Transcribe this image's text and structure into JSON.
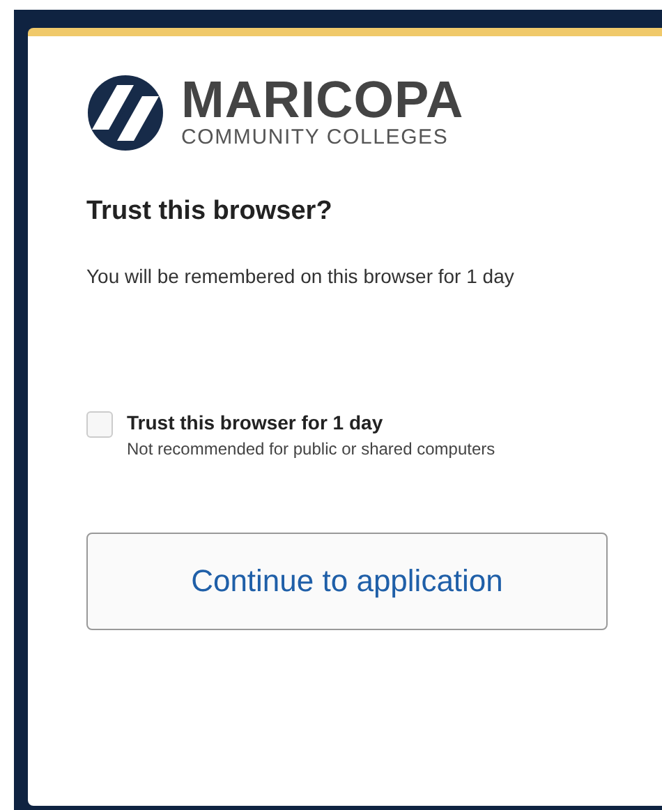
{
  "logo": {
    "name": "MARICOPA",
    "subtitle": "COMMUNITY COLLEGES"
  },
  "heading": "Trust this browser?",
  "message": "You will be remembered on this browser for 1 day",
  "trust_option": {
    "label": "Trust this browser for 1 day",
    "hint": "Not recommended for public or shared computers",
    "checked": false
  },
  "buttons": [
    "Continue to application"
  ]
}
